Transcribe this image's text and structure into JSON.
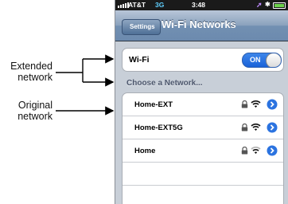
{
  "annotations": {
    "extended_network": "Extended\nnetwork",
    "original_network": "Original\nnetwork"
  },
  "status_bar": {
    "carrier": "AT&T",
    "network_type": "3G",
    "time": "3:48"
  },
  "nav": {
    "back_label": "Settings",
    "title": "Wi-Fi Networks"
  },
  "wifi": {
    "label": "Wi-Fi",
    "toggle_state": "ON"
  },
  "section_header": "Choose a Network...",
  "networks": [
    {
      "name": "Home-EXT"
    },
    {
      "name": "Home-EXT5G"
    },
    {
      "name": "Home"
    }
  ],
  "colors": {
    "toggle_on": "#1a62d8",
    "chevron": "#2b73e0",
    "nav_bar": "#7290b2"
  }
}
